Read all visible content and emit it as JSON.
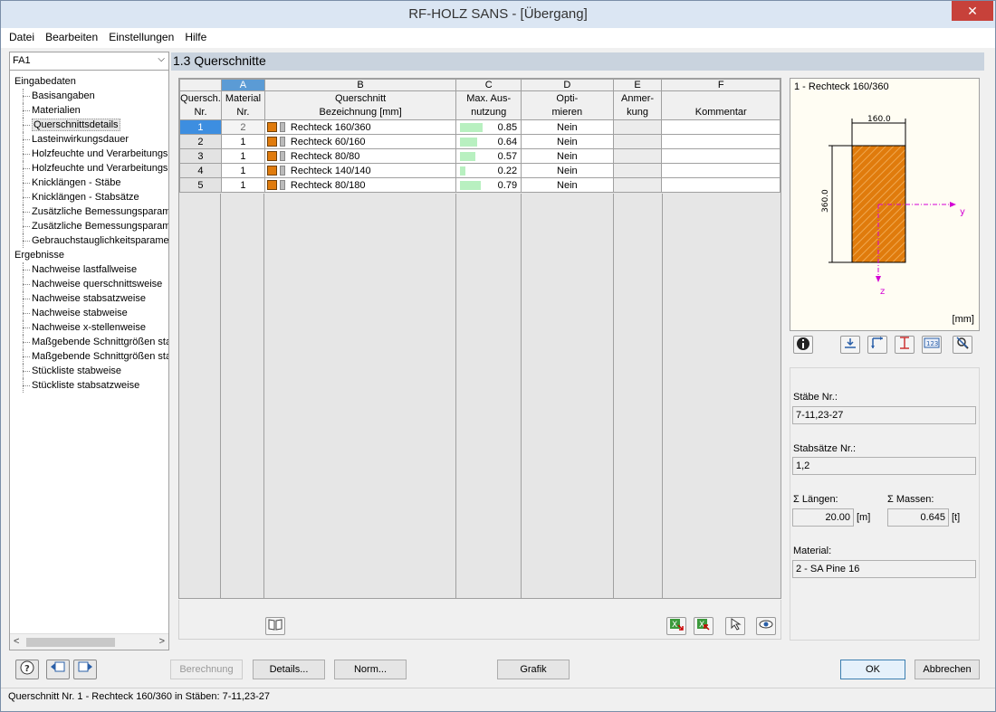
{
  "window": {
    "title": "RF-HOLZ SANS - [Übergang]",
    "close": "✕"
  },
  "menu": [
    "Datei",
    "Bearbeiten",
    "Einstellungen",
    "Hilfe"
  ],
  "nav": {
    "combo_value": "FA1",
    "input_group": "Eingabedaten",
    "input_items": [
      "Basisangaben",
      "Materialien",
      "Querschnittsdetails",
      "Lasteinwirkungsdauer",
      "Holzfeuchte und Verarbeitungs",
      "Holzfeuchte und Verarbeitungs",
      "Knicklängen - Stäbe",
      "Knicklängen - Stabsätze",
      "Zusätzliche Bemessungsparame",
      "Zusätzliche Bemessungsparame",
      "Gebrauchstauglichkeitsparamet"
    ],
    "results_group": "Ergebnisse",
    "result_items": [
      "Nachweise lastfallweise",
      "Nachweise querschnittsweise",
      "Nachweise stabsatzweise",
      "Nachweise stabweise",
      "Nachweise x-stellenweise",
      "Maßgebende Schnittgrößen sta",
      "Maßgebende Schnittgrößen sta",
      "Stückliste stabweise",
      "Stückliste stabsatzweise"
    ]
  },
  "section_title": "1.3 Querschnitte",
  "table": {
    "letters": [
      "A",
      "B",
      "C",
      "D",
      "E",
      "F"
    ],
    "rowhead": "Quersch.\nNr.",
    "headers": [
      "Material\nNr.",
      "Querschnitt\nBezeichnung [mm]",
      "Max. Aus-\nnutzung",
      "Opti-\nmieren",
      "Anmer-\nkung",
      "Kommentar"
    ],
    "rows": [
      {
        "nr": "1",
        "material": "2",
        "name": "Rechteck 160/360",
        "util": "0.85",
        "util_frac": 0.85,
        "opt": "Nein"
      },
      {
        "nr": "2",
        "material": "1",
        "name": "Rechteck 60/160",
        "util": "0.64",
        "util_frac": 0.64,
        "opt": "Nein"
      },
      {
        "nr": "3",
        "material": "1",
        "name": "Rechteck 80/80",
        "util": "0.57",
        "util_frac": 0.57,
        "opt": "Nein"
      },
      {
        "nr": "4",
        "material": "1",
        "name": "Rechteck 140/140",
        "util": "0.22",
        "util_frac": 0.22,
        "opt": "Nein"
      },
      {
        "nr": "5",
        "material": "1",
        "name": "Rechteck 80/180",
        "util": "0.79",
        "util_frac": 0.79,
        "opt": "Nein"
      }
    ]
  },
  "preview": {
    "title": "1 - Rechteck 160/360",
    "width_dim": "160.0",
    "height_dim": "360.0",
    "axis_y": "y",
    "axis_z": "z",
    "unit": "[mm]"
  },
  "props": {
    "staebe_label": "Stäbe Nr.:",
    "staebe_value": "7-11,23-27",
    "stabsaetze_label": "Stabsätze Nr.:",
    "stabsaetze_value": "1,2",
    "laengen_label": "Σ Längen:",
    "laengen_value": "20.00",
    "laengen_unit": "[m]",
    "massen_label": "Σ Massen:",
    "massen_value": "0.645",
    "massen_unit": "[t]",
    "material_label": "Material:",
    "material_value": "2 - SA Pine 16"
  },
  "buttons": {
    "berechnung": "Berechnung",
    "details": "Details...",
    "norm": "Norm...",
    "grafik": "Grafik",
    "ok": "OK",
    "abbrechen": "Abbrechen"
  },
  "status": "Querschnitt Nr. 1 - Rechteck 160/360 in Stäben: 7-11,23-27",
  "colors": {
    "accent": "#3d8ee0",
    "material_swatch": "#e07b0c",
    "util_bar": "#b8f0c0",
    "section_fill": "#e07b0c",
    "axis": "#d400d4"
  },
  "icons": [
    "help-icon",
    "prev-icon",
    "next-icon",
    "book-icon",
    "excel-export-icon",
    "excel-import-icon",
    "pick-icon",
    "view-icon",
    "info-icon",
    "member-icon",
    "axes-icon",
    "dimension-icon",
    "numbering-icon",
    "zoom-reset-icon"
  ]
}
